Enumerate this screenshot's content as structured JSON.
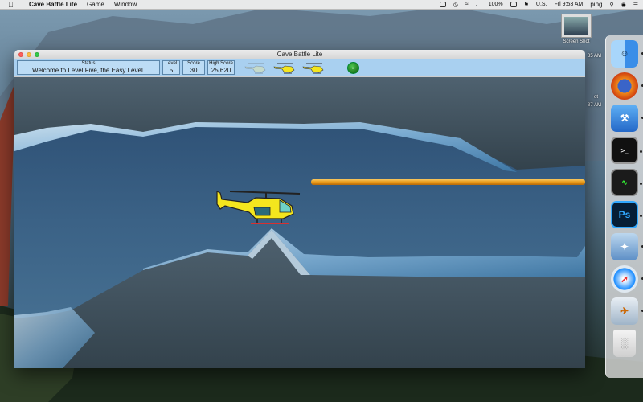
{
  "menubar": {
    "apple_icon": "apple-icon",
    "app_name": "Cave Battle Lite",
    "menus": [
      "Game",
      "Window"
    ],
    "battery": "100%",
    "input_source": "U.S.",
    "clock": "Fri 9:53 AM",
    "user": "ping"
  },
  "desktop": {
    "file_label": "Screen Shot",
    "partial_time_1": "35 AM",
    "partial_time_2": "ot",
    "partial_time_3": "37 AM"
  },
  "dock": {
    "items": [
      {
        "name": "Finder",
        "icon": "finder-icon",
        "color": "#5ab2f2"
      },
      {
        "name": "Firefox",
        "icon": "firefox-icon",
        "color": "#e66000"
      },
      {
        "name": "Xcode",
        "icon": "xcode-icon",
        "color": "#3b8de0"
      },
      {
        "name": "Terminal",
        "icon": "terminal-icon",
        "color": "#111111"
      },
      {
        "name": "Activity Monitor",
        "icon": "activity-monitor-icon",
        "color": "#1a1a1a"
      },
      {
        "name": "Photoshop",
        "icon": "photoshop-icon",
        "color": "#001d34"
      },
      {
        "name": "Preview",
        "icon": "preview-icon",
        "color": "#6d9fd0"
      },
      {
        "name": "Safari",
        "icon": "safari-icon",
        "color": "#1a8cff"
      },
      {
        "name": "Utility",
        "icon": "utility-icon",
        "color": "#cfd8e0"
      },
      {
        "name": "Trash",
        "icon": "trash-icon",
        "color": "#e5e5e5"
      }
    ]
  },
  "window": {
    "title": "Cave Battle Lite",
    "hud": {
      "status_label": "Status",
      "status_text": "Welcome to Level Five, the Easy Level.",
      "level_label": "Level",
      "level_value": "5",
      "score_label": "Score",
      "score_value": "30",
      "high_score_label": "High Score",
      "high_score_value": "25,620"
    },
    "lives_remaining": 3,
    "pause_button_label": "II"
  },
  "colors": {
    "hud_bg": "#a9d0f0",
    "helicopter_yellow": "#f4e61e",
    "laser": "#f0a020",
    "cave_water": "#355a80"
  }
}
